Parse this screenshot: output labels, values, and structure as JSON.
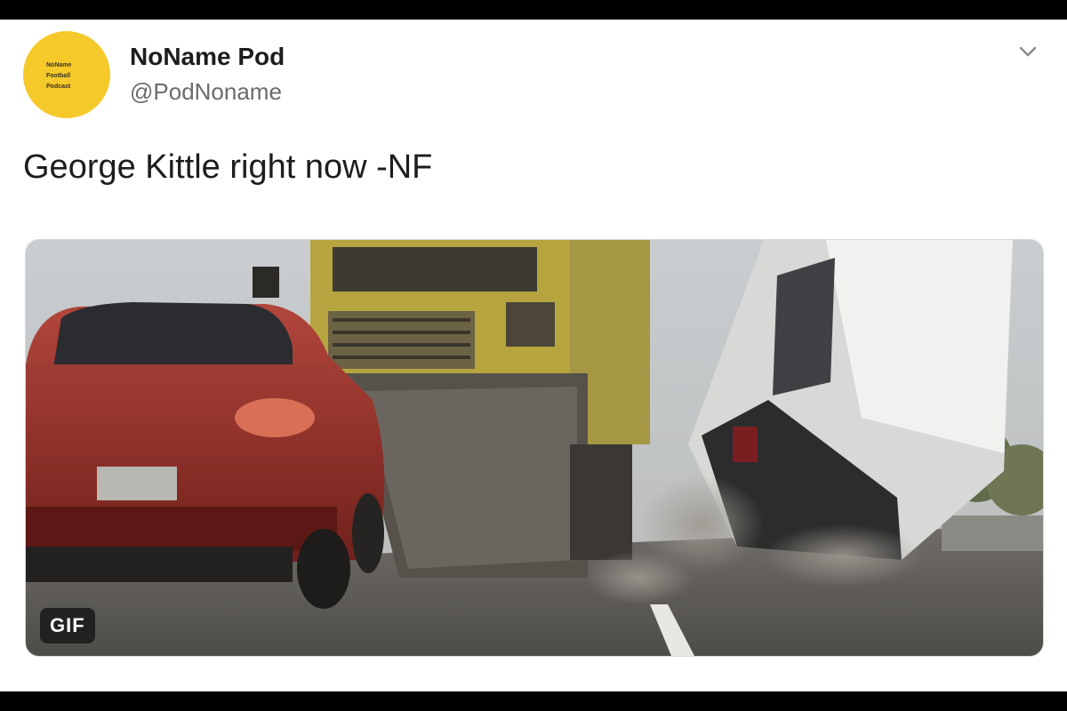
{
  "tweet": {
    "display_name": "NoName Pod",
    "handle": "@PodNoname",
    "text": "George Kittle right now -NF",
    "avatar": {
      "line1": "NoName",
      "line2": "Football",
      "line3": "Podcast",
      "color": "#f6c92a"
    },
    "media": {
      "badge": "GIF"
    },
    "menu_icon": "chevron-down-icon"
  }
}
